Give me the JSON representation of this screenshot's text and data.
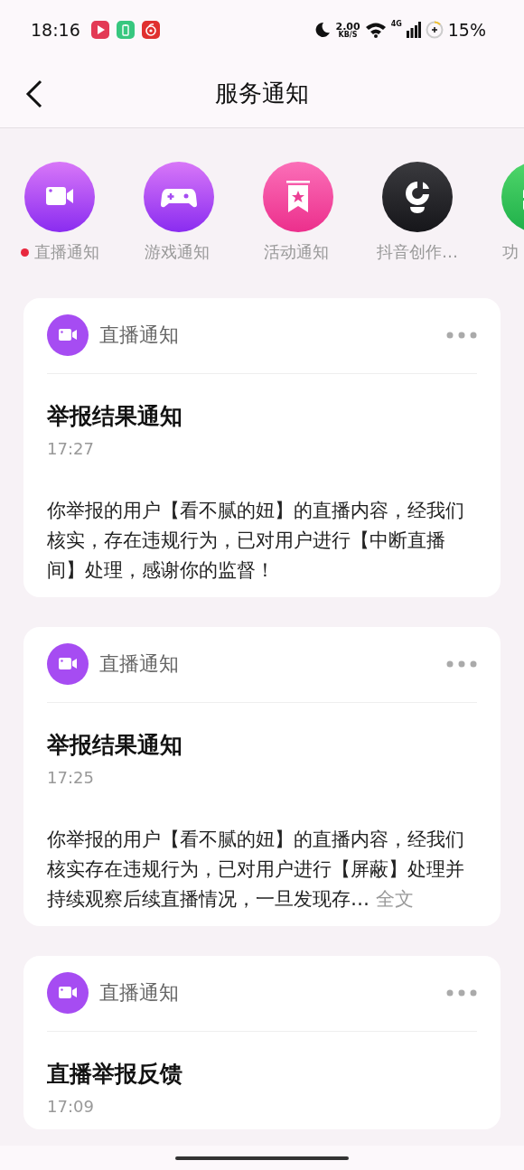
{
  "status_bar": {
    "time": "18:16",
    "apps": [
      {
        "kind": "play"
      },
      {
        "kind": "battery"
      },
      {
        "kind": "music"
      }
    ],
    "speed_value": "2.00",
    "speed_unit": "KB/S",
    "network": "4G",
    "battery": "15%"
  },
  "header": {
    "title": "服务通知"
  },
  "categories": [
    {
      "kind": "video",
      "label": "直播通知",
      "unread": true
    },
    {
      "kind": "gamepad",
      "label": "游戏通知",
      "unread": false
    },
    {
      "kind": "bookmark",
      "label": "活动通知",
      "unread": false
    },
    {
      "kind": "bulb",
      "label": "抖音创作…",
      "unread": false
    },
    {
      "kind": "gift",
      "label": "功",
      "unread": false
    }
  ],
  "notifications": [
    {
      "source": "直播通知",
      "title": "举报结果通知",
      "time": "17:27",
      "body": "你举报的用户【看不腻的妞】的直播内容，经我们核实，存在违规行为，已对用户进行【中断直播间】处理，感谢你的监督！"
    },
    {
      "source": "直播通知",
      "title": "举报结果通知",
      "time": "17:25",
      "body": "你举报的用户【看不腻的妞】的直播内容，经我们核实存在违规行为，已对用户进行【屏蔽】处理并持续观察后续直播情况，一旦发现存…",
      "more": "全文"
    },
    {
      "source": "直播通知",
      "title": "直播举报反馈",
      "time": "17:09"
    }
  ]
}
